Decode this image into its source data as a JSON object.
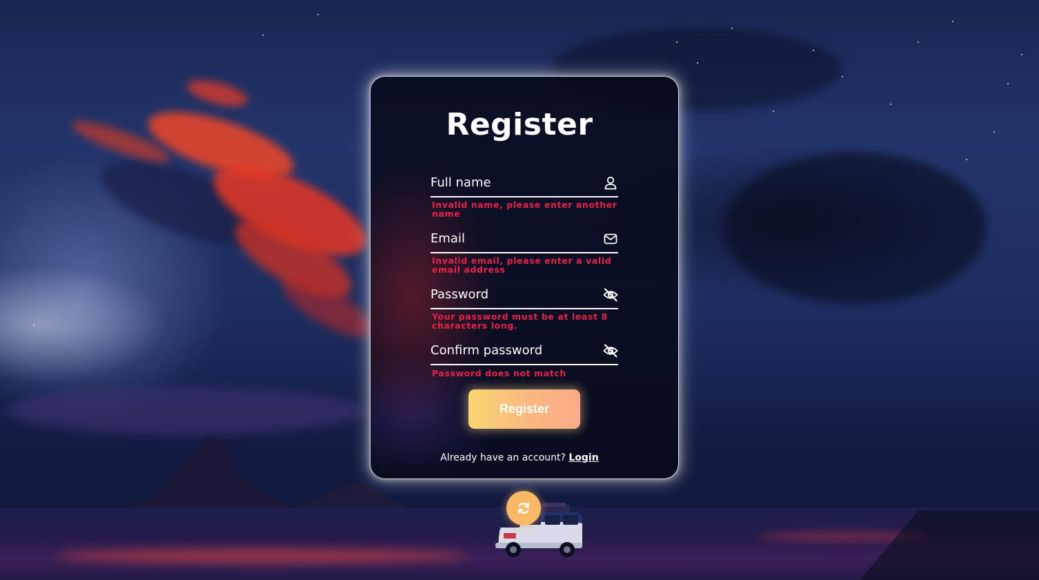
{
  "page": {
    "title": "Register"
  },
  "form": {
    "fields": [
      {
        "label": "Full name",
        "icon": "user-icon",
        "error": "Invalid name, please enter another name"
      },
      {
        "label": "Email",
        "icon": "envelope-icon",
        "error": "Invalid email, please enter a valid email address"
      },
      {
        "label": "Password",
        "icon": "eye-slash-icon",
        "error": "Your password must be at least 8 characters long."
      },
      {
        "label": "Confirm password",
        "icon": "eye-slash-icon",
        "error": "Password does not match"
      }
    ],
    "submit_label": "Register"
  },
  "footer": {
    "prompt": "Already have an account?",
    "login_label": "Login"
  },
  "colors": {
    "error": "#e8244a",
    "button_gradient_start": "#f9d570",
    "button_gradient_end": "#fbab86",
    "refresh_button": "#f9b967",
    "card_background": "#080a1c"
  },
  "refresh_button": {
    "icon": "refresh-icon"
  }
}
